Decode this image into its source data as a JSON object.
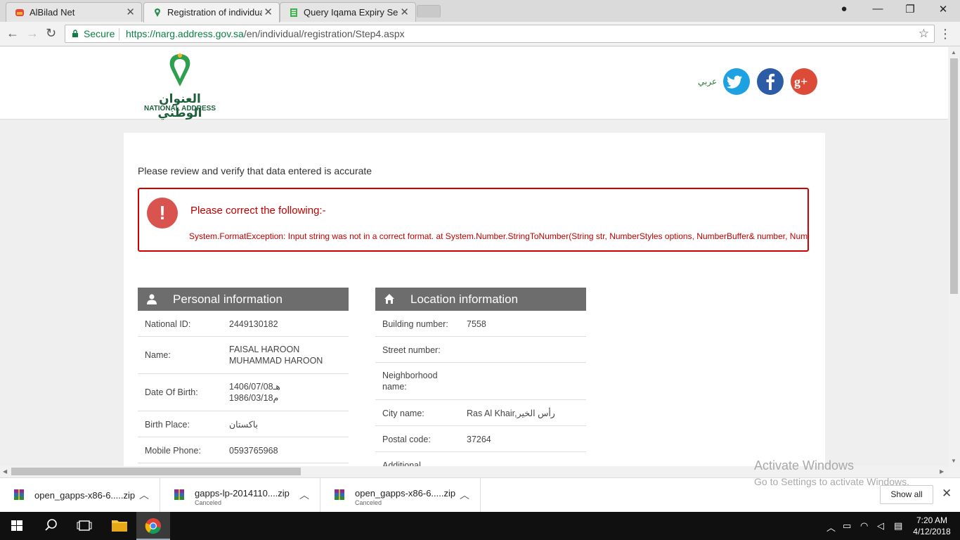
{
  "browser": {
    "tabs": [
      {
        "title": "AlBilad Net",
        "active": false
      },
      {
        "title": "Registration of individual",
        "active": true
      },
      {
        "title": "Query Iqama Expiry Servi",
        "active": false
      }
    ],
    "secure_label": "Secure",
    "url_host": "https://narg.address.gov.sa",
    "url_path": "/en/individual/registration/Step4.aspx"
  },
  "site": {
    "logo_ar": "العنوان الوطني",
    "logo_en": "NATIONAL ADDRESS",
    "lang_link": "عربي",
    "social": [
      "twitter",
      "facebook",
      "google-plus"
    ]
  },
  "main": {
    "intro": "Please review and verify that data entered is accurate",
    "error_title": "Please correct the following:-",
    "error_detail": "System.FormatException: Input string was not in a correct format. at System.Number.StringToNumber(String str, NumberStyles options, NumberBuffer& number, NumberFormatInfo info, Boolean parseDe"
  },
  "personal": {
    "title": "Personal information",
    "rows": [
      {
        "label": "National ID:",
        "value": "2449130182"
      },
      {
        "label": "Name:",
        "value": "FAISAL HAROON",
        "value2": "MUHAMMAD HAROON"
      },
      {
        "label": "Date Of Birth:",
        "value": "1406/07/08هـ",
        "value2": "1986/03/18م"
      },
      {
        "label": "Birth Place:",
        "value": "باكستان"
      },
      {
        "label": "Mobile Phone:",
        "value": "0593765968"
      }
    ]
  },
  "location": {
    "title": "Location information",
    "rows": [
      {
        "label": "Building number:",
        "value": "7558"
      },
      {
        "label": "Street number:",
        "value": ""
      },
      {
        "label": "Neighborhood",
        "label2": "name:",
        "value": ""
      },
      {
        "label": "City name:",
        "value": "Ras Al Khair,رأس الخير"
      },
      {
        "label": "Postal code:",
        "value": "37264"
      },
      {
        "label": "Additional",
        "value": ""
      }
    ]
  },
  "watermark": {
    "line1": "Activate Windows",
    "line2": "Go to Settings to activate Windows."
  },
  "downloads": {
    "items": [
      {
        "file": "open_gapps-x86-6.....zip",
        "status": ""
      },
      {
        "file": "gapps-lp-2014110....zip",
        "status": "Canceled"
      },
      {
        "file": "open_gapps-x86-6.....zip",
        "status": "Canceled"
      }
    ],
    "show_all": "Show all"
  },
  "taskbar": {
    "time": "7:20 AM",
    "date": "4/12/2018"
  }
}
